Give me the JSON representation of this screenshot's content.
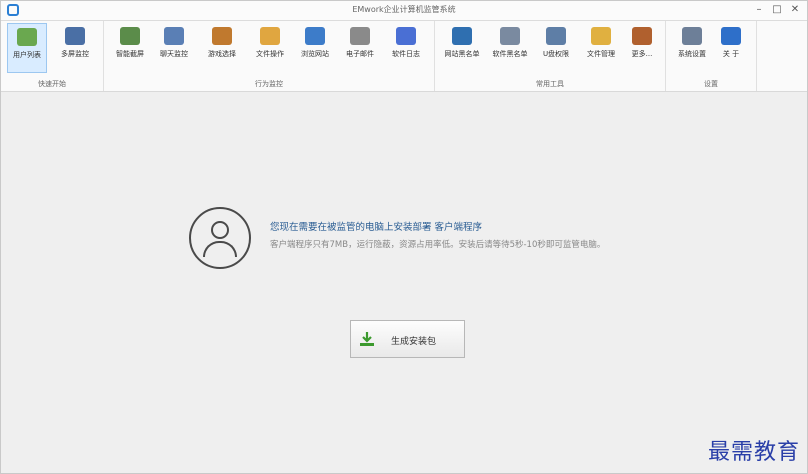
{
  "window": {
    "title": "EMwork企业计算机监管系统"
  },
  "ribbon": {
    "groups": [
      {
        "label": "快速开始",
        "tools": [
          {
            "label": "用户列表",
            "icon": "users-icon",
            "color": "#6aa84f",
            "active": true
          },
          {
            "label": "多屏监控",
            "icon": "monitors-icon",
            "color": "#4a6fa5"
          }
        ]
      },
      {
        "label": "行为监控",
        "tools": [
          {
            "label": "智能截屏",
            "icon": "screenshot-icon",
            "color": "#5b8c4a"
          },
          {
            "label": "聊天监控",
            "icon": "chat-icon",
            "color": "#5a7fb5"
          },
          {
            "label": "游戏选择",
            "icon": "game-icon",
            "color": "#c0792e"
          },
          {
            "label": "文件操作",
            "icon": "folder-icon",
            "color": "#e0a640"
          },
          {
            "label": "浏览网站",
            "icon": "compass-icon",
            "color": "#3d7cc9"
          },
          {
            "label": "电子邮件",
            "icon": "mail-icon",
            "color": "#8a8a8a"
          },
          {
            "label": "软件日志",
            "icon": "infinity-icon",
            "color": "#4a6fd4"
          }
        ]
      },
      {
        "label": "常用工具",
        "tools": [
          {
            "label": "网站黑名单",
            "icon": "globe-block-icon",
            "color": "#2f6fb0"
          },
          {
            "label": "软件黑名单",
            "icon": "app-block-icon",
            "color": "#7a8aa0"
          },
          {
            "label": "U盘权限",
            "icon": "usb-icon",
            "color": "#5e7ea6"
          },
          {
            "label": "文件管理",
            "icon": "file-manager-icon",
            "color": "#e0b040"
          },
          {
            "label": "更多...",
            "icon": "toolbox-icon",
            "color": "#b0602e"
          }
        ]
      },
      {
        "label": "设置",
        "tools": [
          {
            "label": "系统设置",
            "icon": "gear-icon",
            "color": "#6d7f98"
          },
          {
            "label": "关  于",
            "icon": "info-icon",
            "color": "#2e6fc9"
          }
        ]
      }
    ]
  },
  "main": {
    "headline": "您现在需要在被监管的电脑上安装部署 客户端程序",
    "description": "客户端程序只有7MB，运行隐蔽，资源占用率低。安装后请等待5秒-10秒即可监管电脑。",
    "button_label": "生成安装包"
  },
  "watermark": "最需教育"
}
